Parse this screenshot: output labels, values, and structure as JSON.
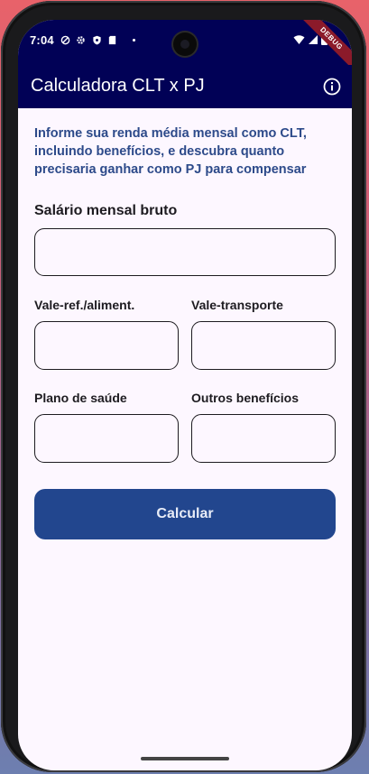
{
  "status_bar": {
    "time": "7:04",
    "debug_label": "DEBUG"
  },
  "app_bar": {
    "title": "Calculadora CLT x PJ",
    "info_icon": "info-icon"
  },
  "intro_text": "Informe sua renda média mensal como CLT, incluindo benefícios, e descubra quanto precisaria ganhar como PJ para compensar",
  "fields": {
    "salary": {
      "label": "Salário mensal bruto",
      "value": ""
    },
    "meal_voucher": {
      "label": "Vale-ref./aliment.",
      "value": ""
    },
    "transport_voucher": {
      "label": "Vale-transporte",
      "value": ""
    },
    "health_plan": {
      "label": "Plano de saúde",
      "value": ""
    },
    "other_benefits": {
      "label": "Outros benefícios",
      "value": ""
    }
  },
  "calculate_button": {
    "label": "Calcular"
  },
  "colors": {
    "app_bar": "#010156",
    "accent_text": "#2d4a8a",
    "button": "#22468e",
    "background": "#fdf7ff"
  }
}
